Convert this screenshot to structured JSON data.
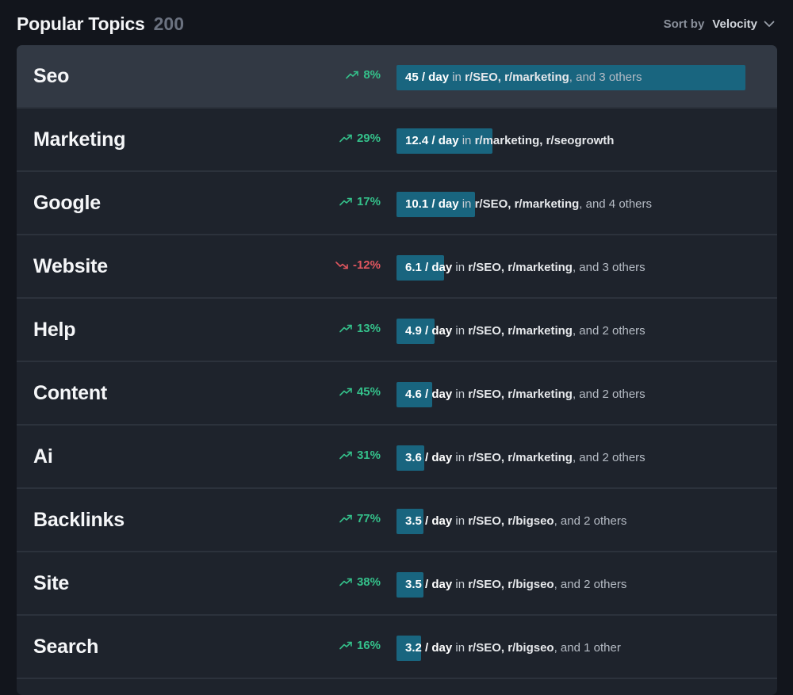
{
  "header": {
    "title": "Popular Topics",
    "count": "200",
    "sort_label": "Sort by",
    "sort_value": "Velocity"
  },
  "colors": {
    "background": "#12151c",
    "panel": "#1e232c",
    "active_row": "#323944",
    "bar": "#19657f",
    "positive": "#34c08a",
    "negative": "#e0565f"
  },
  "velocity_max": 45,
  "topics": [
    {
      "name": "Seo",
      "change": "8%",
      "trend": "up",
      "rate": "45 / day",
      "rate_value": 45,
      "in": " in ",
      "subs": "r/SEO, r/marketing",
      "others": ", and 3 others"
    },
    {
      "name": "Marketing",
      "change": "29%",
      "trend": "up",
      "rate": "12.4 / day",
      "rate_value": 12.4,
      "in": " in ",
      "subs": "r/marketing, r/seogrowth",
      "others": ""
    },
    {
      "name": "Google",
      "change": "17%",
      "trend": "up",
      "rate": "10.1 / day",
      "rate_value": 10.1,
      "in": " in ",
      "subs": "r/SEO, r/marketing",
      "others": ", and 4 others"
    },
    {
      "name": "Website",
      "change": "-12%",
      "trend": "down",
      "rate": "6.1 / day",
      "rate_value": 6.1,
      "in": " in ",
      "subs": "r/SEO, r/marketing",
      "others": ", and 3 others"
    },
    {
      "name": "Help",
      "change": "13%",
      "trend": "up",
      "rate": "4.9 / day",
      "rate_value": 4.9,
      "in": " in ",
      "subs": "r/SEO, r/marketing",
      "others": ", and 2 others"
    },
    {
      "name": "Content",
      "change": "45%",
      "trend": "up",
      "rate": "4.6 / day",
      "rate_value": 4.6,
      "in": " in ",
      "subs": "r/SEO, r/marketing",
      "others": ", and 2 others"
    },
    {
      "name": "Ai",
      "change": "31%",
      "trend": "up",
      "rate": "3.6 / day",
      "rate_value": 3.6,
      "in": " in ",
      "subs": "r/SEO, r/marketing",
      "others": ", and 2 others"
    },
    {
      "name": "Backlinks",
      "change": "77%",
      "trend": "up",
      "rate": "3.5 / day",
      "rate_value": 3.5,
      "in": " in ",
      "subs": "r/SEO, r/bigseo",
      "others": ", and 2 others"
    },
    {
      "name": "Site",
      "change": "38%",
      "trend": "up",
      "rate": "3.5 / day",
      "rate_value": 3.5,
      "in": " in ",
      "subs": "r/SEO, r/bigseo",
      "others": ", and 2 others"
    },
    {
      "name": "Search",
      "change": "16%",
      "trend": "up",
      "rate": "3.2 / day",
      "rate_value": 3.2,
      "in": " in ",
      "subs": "r/SEO, r/bigseo",
      "others": ", and 1 other"
    }
  ]
}
